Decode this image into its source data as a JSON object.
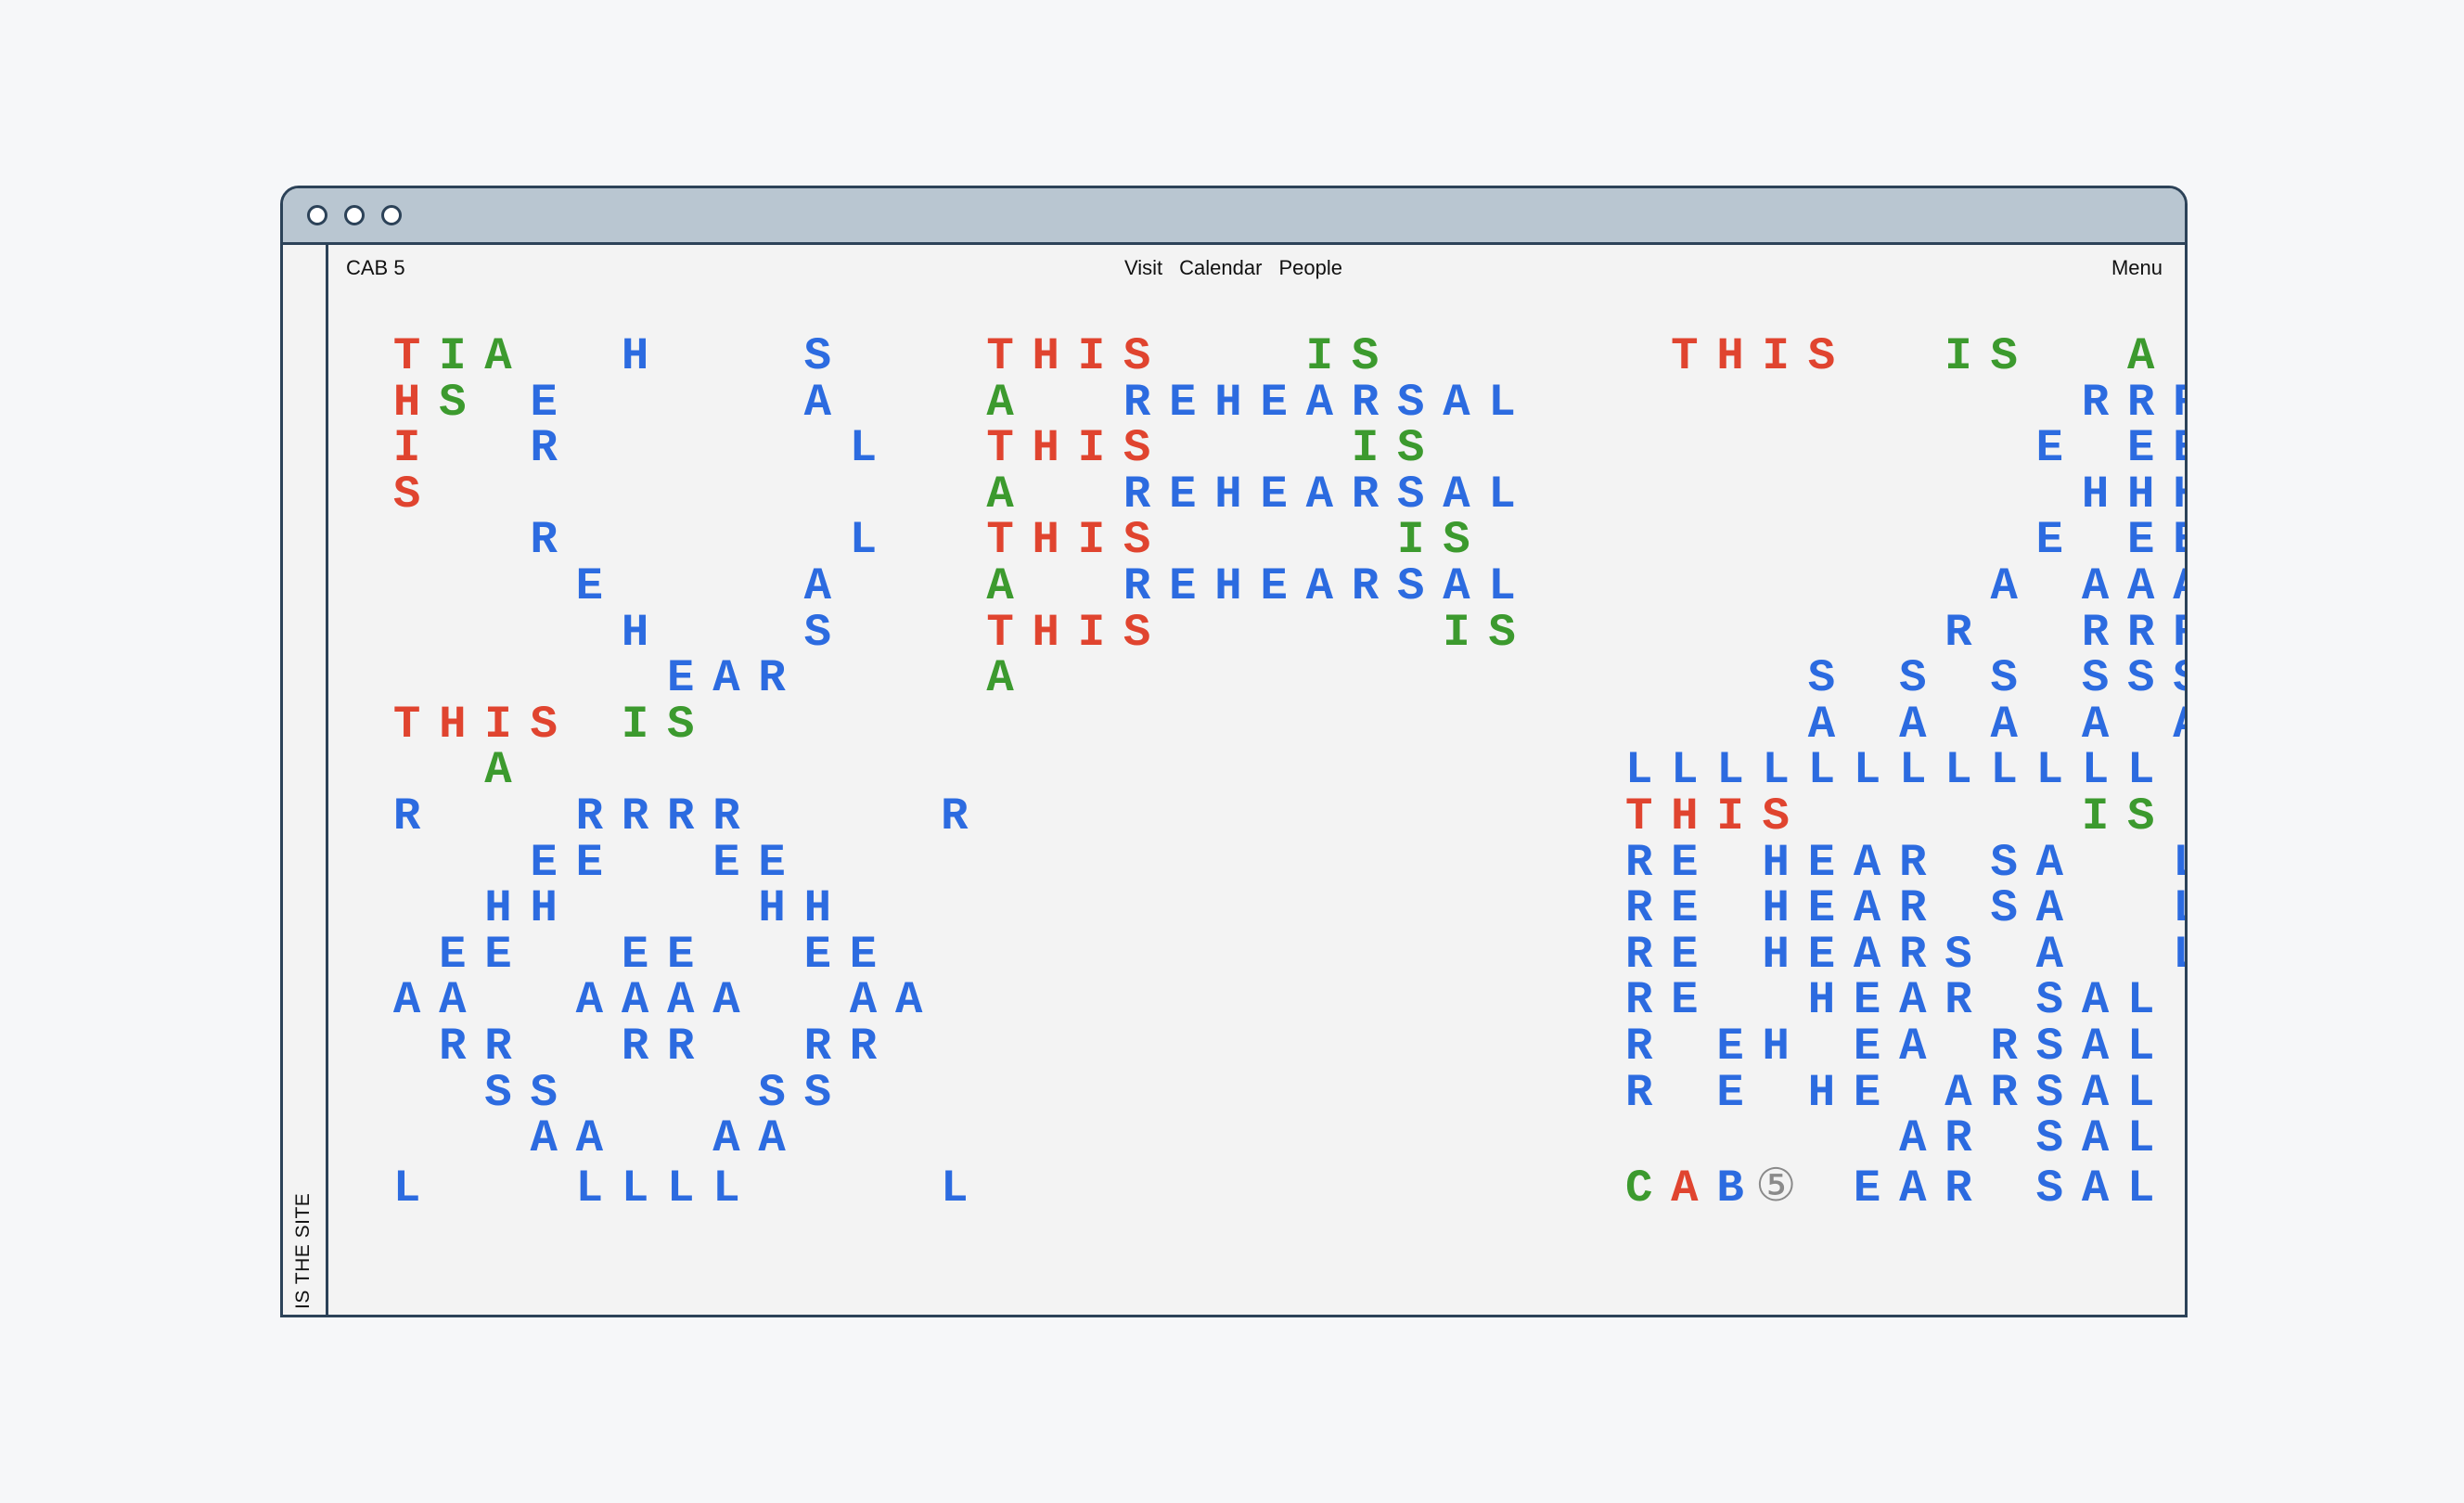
{
  "window": {
    "buttons": [
      "close",
      "minimize",
      "maximize"
    ]
  },
  "sidebar": {
    "label": "IS THE SITE"
  },
  "nav": {
    "brand": "CAB 5",
    "links": [
      "Visit",
      "Calendar",
      "People"
    ],
    "menu": "Menu"
  },
  "colors": {
    "r": "#e0442f",
    "g": "#3c9a2e",
    "b": "#2c6be0",
    "o": "#8a8a8a"
  },
  "grid_rows": [
    {
      "text": "TIA  H   S   THIS   IS      THIS  IS  A",
      "colors": "rgg..b...b...rrrr...gg......rrrr..gg..g"
    },
    {
      "text": "HS E     A   A  REHEARSAL            RRR",
      "colors": "rg.b.....b...g..bbbbbbbbb............bbb"
    },
    {
      "text": "I  R      L  THIS    IS             E EE",
      "colors": "r..b......b..rrrr....gg.............b.bb"
    },
    {
      "text": "S            A  REHEARSAL            HHH",
      "colors": "r............g..bbbbbbbbb............bbb"
    },
    {
      "text": "   R      L  THIS     IS            E EE",
      "colors": "...b......b..rrrr.....gg............b.bb"
    },
    {
      "text": "    E    A   A  REHEARSAL          A AAA",
      "colors": "....b....b...g..bbbbbbbbb..........b.bbb"
    },
    {
      "text": "     H   S   THIS      IS         R  RRR",
      "colors": ".....b...b...rrrr......gg.........b..bbb"
    },
    {
      "text": "      EAR    A                 S S S SSS",
      "colors": "......bbb....g.................b.b.b.bbb"
    },
    {
      "text": "THIS IS                        A A A A AA",
      "colors": "rrrr.gg........................b.b.b.b.bb"
    },
    {
      "text": "  A                        LLLLLLLLLLLL",
      "colors": "..g........................bbbbbbbbbbbb"
    },
    {
      "text": "R   RRRR    R              THIS      IS  A",
      "colors": "b...bbbb....b..............rrrr......gg..g"
    },
    {
      "text": "   EE  EE                  RE HEAR SA  L",
      "colors": "...bb..bb..................bb.bbbb.bb..b"
    },
    {
      "text": "  HH    HH                 RE HEAR SA  L",
      "colors": "..bb....bb.................bb.bbbb.bb..b"
    },
    {
      "text": " EE  EE  EE                RE HEARS A  L",
      "colors": ".bb..bb..bb................bb.bbbbb.b..b"
    },
    {
      "text": "AA  AAAA  AA               RE  HEAR SAL",
      "colors": "bb..bbbb..bb...............bb..bbbb.bbb"
    },
    {
      "text": " RR  RR  RR                R EH EA RSAL",
      "colors": ".bb..bb..bb................b.bb.bb.bbbb"
    },
    {
      "text": "  SS    SS                 R E HE ARSAL",
      "colors": "..ss....ss.................b.b.bb.bbbbb"
    },
    {
      "text": "   AA  AA                        AR SAL",
      "colors": "...bb..bb........................bb.bbb"
    },
    {
      "text": "L   LLLL    L              CAB⑤ EAR SAL",
      "colors": "b...bbbb....b..............grbo.bbb.bbb"
    }
  ]
}
